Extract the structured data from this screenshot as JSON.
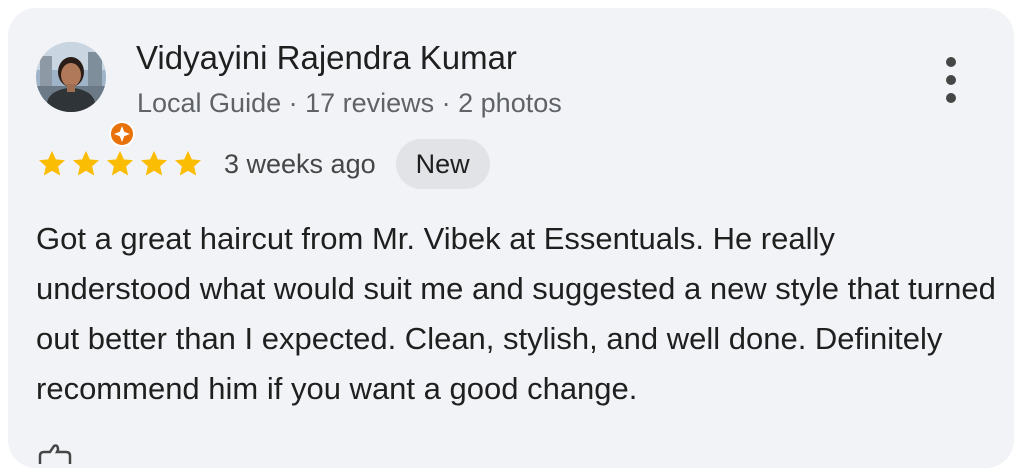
{
  "reviewer": {
    "name": "Vidyayini Rajendra Kumar",
    "meta": "Local Guide · 17 reviews · 2 photos",
    "avatar_icon": "user-avatar-photo",
    "badge_icon": "local-guide-badge-icon"
  },
  "review": {
    "rating": 5,
    "max_rating": 5,
    "star_color": "#fbbc04",
    "age": "3 weeks ago",
    "badge": "New",
    "text": "Got a great haircut from Mr. Vibek at Essentuals. He really understood what would suit me and suggested a new style that turned out better than I expected. Clean, stylish, and well done. Definitely recommend him if you want a good change."
  },
  "actions": {
    "more_icon": "more-vertical-icon"
  },
  "colors": {
    "card_background": "#f2f3f6",
    "badge_orange": "#e8710a"
  }
}
